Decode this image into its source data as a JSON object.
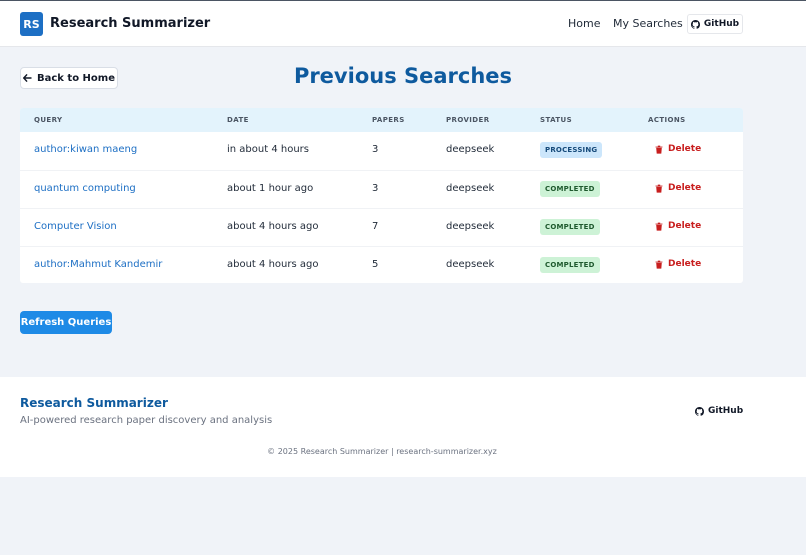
{
  "header": {
    "logo_text": "RS",
    "brand": "Research Summarizer",
    "nav": {
      "home": "Home",
      "my_searches": "My Searches",
      "github": "GitHub"
    }
  },
  "main": {
    "back_label": "Back to Home",
    "title": "Previous Searches",
    "columns": [
      "QUERY",
      "DATE",
      "PAPERS",
      "PROVIDER",
      "STATUS",
      "ACTIONS"
    ],
    "rows": [
      {
        "query": "author:kiwan maeng",
        "date": "in about 4 hours",
        "papers": "3",
        "provider": "deepseek",
        "status": "PROCESSING",
        "action": "Delete"
      },
      {
        "query": "quantum computing",
        "date": "about 1 hour ago",
        "papers": "3",
        "provider": "deepseek",
        "status": "COMPLETED",
        "action": "Delete"
      },
      {
        "query": "Computer Vision",
        "date": "about 4 hours ago",
        "papers": "7",
        "provider": "deepseek",
        "status": "COMPLETED",
        "action": "Delete"
      },
      {
        "query": "author:Mahmut Kandemir",
        "date": "about 4 hours ago",
        "papers": "5",
        "provider": "deepseek",
        "status": "COMPLETED",
        "action": "Delete"
      }
    ],
    "refresh_label": "Refresh Queries"
  },
  "footer": {
    "title": "Research Summarizer",
    "subtitle": "AI-powered research paper discovery and analysis",
    "github": "GitHub",
    "copyright": "© 2025 Research Summarizer | research-summarizer.xyz"
  },
  "colors": {
    "accent": "#1d6fc4",
    "title": "#0e5a9e",
    "processing_badge": "#cce6fb",
    "completed_badge": "#cdf2d6",
    "delete": "#c81e1e"
  },
  "icons": {
    "back": "arrow-left-icon",
    "github": "github-icon",
    "delete": "trash-icon"
  }
}
